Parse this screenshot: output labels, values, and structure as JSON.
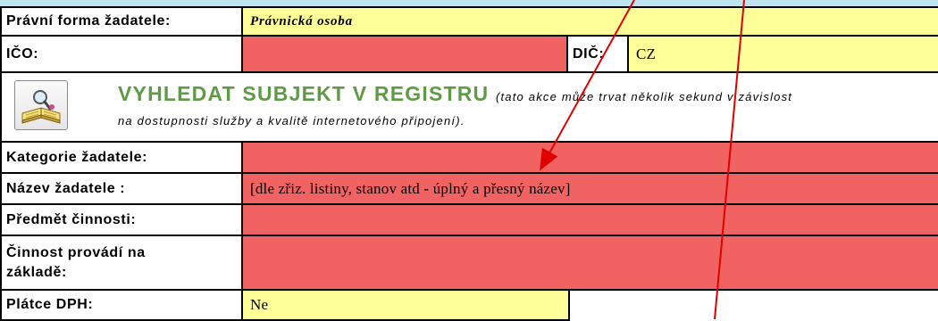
{
  "form": {
    "legal_form_label": "Právní forma žadatele:",
    "legal_form_value": "Právnická osoba",
    "ico_label": "IČO:",
    "ico_value": "",
    "dic_label": "DIČ:",
    "dic_value": "CZ",
    "search": {
      "title": "VYHLEDAT SUBJEKT V REGISTRU",
      "note_part1": "(tato akce může trvat několik sekund v závislost",
      "note_part2": "na dostupnosti služby a kvalitě internetového připojení).",
      "icon": "book-search-icon"
    },
    "category_label": "Kategorie žadatele:",
    "category_value": "",
    "name_label": "Název žadatele :",
    "name_value": "[dle zřiz. listiny, stanov atd - úplný a přesný název]",
    "subject_label": "Předmět činnosti:",
    "subject_value": "",
    "basis_label": "Činnost provádí na základě:",
    "basis_value": "",
    "vat_label": "Plátce DPH:",
    "vat_value": "Ne"
  },
  "colors": {
    "required_fill": "#f16363",
    "input_fill": "#ffff99",
    "header_strip": "#bfe3ef",
    "search_title": "#5f9a46",
    "annotation_arrow": "#e00000"
  }
}
